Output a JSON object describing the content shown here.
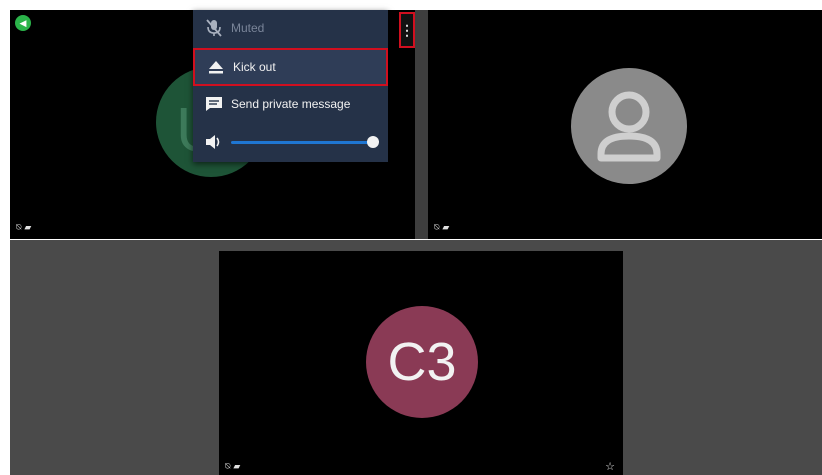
{
  "participants": [
    {
      "avatar_letter": "U",
      "status_icons": [
        "mic-muted-icon",
        "camera-off-icon"
      ],
      "status_glyphs": {
        "mic": "⍉",
        "cam": "▰"
      },
      "avatar_color": "#1e5437"
    },
    {
      "avatar_type": "generic-person",
      "status_glyphs": {
        "mic": "⍉",
        "cam": "▰"
      },
      "avatar_color": "#8a8a8a"
    },
    {
      "initials": "C3",
      "status_glyphs": {
        "mic": "⍉",
        "cam": "▰"
      },
      "avatar_color": "#8a3a55",
      "moderator_icon": "star-icon",
      "star_glyph": "☆"
    }
  ],
  "menu": {
    "dots_glyph": "⋮",
    "items": [
      {
        "label": "Muted",
        "icon": "mic-off-icon",
        "glyph": "🎙",
        "disabled": true
      },
      {
        "label": "Kick out",
        "icon": "eject-icon",
        "glyph": "⏏",
        "highlighted": true
      },
      {
        "label": "Send private message",
        "icon": "message-icon",
        "glyph": "▤"
      }
    ],
    "volume": {
      "icon": "volume-icon",
      "glyph": "🔊",
      "level": 1.0
    }
  },
  "badge_glyph": "◀",
  "colors": {
    "menu_bg": "#253248",
    "highlight_border": "#d10f1f",
    "slider": "#1f76d2",
    "badge": "#2bb34a"
  }
}
